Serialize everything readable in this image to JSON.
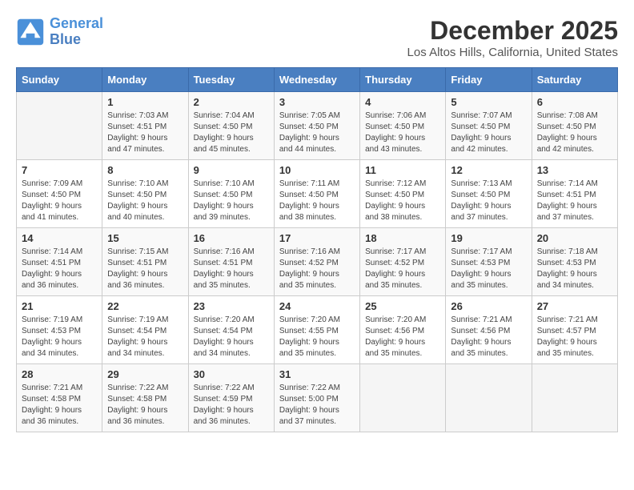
{
  "logo": {
    "line1": "General",
    "line2": "Blue"
  },
  "title": "December 2025",
  "subtitle": "Los Altos Hills, California, United States",
  "weekdays": [
    "Sunday",
    "Monday",
    "Tuesday",
    "Wednesday",
    "Thursday",
    "Friday",
    "Saturday"
  ],
  "weeks": [
    [
      {
        "day": "",
        "info": ""
      },
      {
        "day": "1",
        "info": "Sunrise: 7:03 AM\nSunset: 4:51 PM\nDaylight: 9 hours\nand 47 minutes."
      },
      {
        "day": "2",
        "info": "Sunrise: 7:04 AM\nSunset: 4:50 PM\nDaylight: 9 hours\nand 45 minutes."
      },
      {
        "day": "3",
        "info": "Sunrise: 7:05 AM\nSunset: 4:50 PM\nDaylight: 9 hours\nand 44 minutes."
      },
      {
        "day": "4",
        "info": "Sunrise: 7:06 AM\nSunset: 4:50 PM\nDaylight: 9 hours\nand 43 minutes."
      },
      {
        "day": "5",
        "info": "Sunrise: 7:07 AM\nSunset: 4:50 PM\nDaylight: 9 hours\nand 42 minutes."
      },
      {
        "day": "6",
        "info": "Sunrise: 7:08 AM\nSunset: 4:50 PM\nDaylight: 9 hours\nand 42 minutes."
      }
    ],
    [
      {
        "day": "7",
        "info": "Sunrise: 7:09 AM\nSunset: 4:50 PM\nDaylight: 9 hours\nand 41 minutes."
      },
      {
        "day": "8",
        "info": "Sunrise: 7:10 AM\nSunset: 4:50 PM\nDaylight: 9 hours\nand 40 minutes."
      },
      {
        "day": "9",
        "info": "Sunrise: 7:10 AM\nSunset: 4:50 PM\nDaylight: 9 hours\nand 39 minutes."
      },
      {
        "day": "10",
        "info": "Sunrise: 7:11 AM\nSunset: 4:50 PM\nDaylight: 9 hours\nand 38 minutes."
      },
      {
        "day": "11",
        "info": "Sunrise: 7:12 AM\nSunset: 4:50 PM\nDaylight: 9 hours\nand 38 minutes."
      },
      {
        "day": "12",
        "info": "Sunrise: 7:13 AM\nSunset: 4:50 PM\nDaylight: 9 hours\nand 37 minutes."
      },
      {
        "day": "13",
        "info": "Sunrise: 7:14 AM\nSunset: 4:51 PM\nDaylight: 9 hours\nand 37 minutes."
      }
    ],
    [
      {
        "day": "14",
        "info": "Sunrise: 7:14 AM\nSunset: 4:51 PM\nDaylight: 9 hours\nand 36 minutes."
      },
      {
        "day": "15",
        "info": "Sunrise: 7:15 AM\nSunset: 4:51 PM\nDaylight: 9 hours\nand 36 minutes."
      },
      {
        "day": "16",
        "info": "Sunrise: 7:16 AM\nSunset: 4:51 PM\nDaylight: 9 hours\nand 35 minutes."
      },
      {
        "day": "17",
        "info": "Sunrise: 7:16 AM\nSunset: 4:52 PM\nDaylight: 9 hours\nand 35 minutes."
      },
      {
        "day": "18",
        "info": "Sunrise: 7:17 AM\nSunset: 4:52 PM\nDaylight: 9 hours\nand 35 minutes."
      },
      {
        "day": "19",
        "info": "Sunrise: 7:17 AM\nSunset: 4:53 PM\nDaylight: 9 hours\nand 35 minutes."
      },
      {
        "day": "20",
        "info": "Sunrise: 7:18 AM\nSunset: 4:53 PM\nDaylight: 9 hours\nand 34 minutes."
      }
    ],
    [
      {
        "day": "21",
        "info": "Sunrise: 7:19 AM\nSunset: 4:53 PM\nDaylight: 9 hours\nand 34 minutes."
      },
      {
        "day": "22",
        "info": "Sunrise: 7:19 AM\nSunset: 4:54 PM\nDaylight: 9 hours\nand 34 minutes."
      },
      {
        "day": "23",
        "info": "Sunrise: 7:20 AM\nSunset: 4:54 PM\nDaylight: 9 hours\nand 34 minutes."
      },
      {
        "day": "24",
        "info": "Sunrise: 7:20 AM\nSunset: 4:55 PM\nDaylight: 9 hours\nand 35 minutes."
      },
      {
        "day": "25",
        "info": "Sunrise: 7:20 AM\nSunset: 4:56 PM\nDaylight: 9 hours\nand 35 minutes."
      },
      {
        "day": "26",
        "info": "Sunrise: 7:21 AM\nSunset: 4:56 PM\nDaylight: 9 hours\nand 35 minutes."
      },
      {
        "day": "27",
        "info": "Sunrise: 7:21 AM\nSunset: 4:57 PM\nDaylight: 9 hours\nand 35 minutes."
      }
    ],
    [
      {
        "day": "28",
        "info": "Sunrise: 7:21 AM\nSunset: 4:58 PM\nDaylight: 9 hours\nand 36 minutes."
      },
      {
        "day": "29",
        "info": "Sunrise: 7:22 AM\nSunset: 4:58 PM\nDaylight: 9 hours\nand 36 minutes."
      },
      {
        "day": "30",
        "info": "Sunrise: 7:22 AM\nSunset: 4:59 PM\nDaylight: 9 hours\nand 36 minutes."
      },
      {
        "day": "31",
        "info": "Sunrise: 7:22 AM\nSunset: 5:00 PM\nDaylight: 9 hours\nand 37 minutes."
      },
      {
        "day": "",
        "info": ""
      },
      {
        "day": "",
        "info": ""
      },
      {
        "day": "",
        "info": ""
      }
    ]
  ]
}
